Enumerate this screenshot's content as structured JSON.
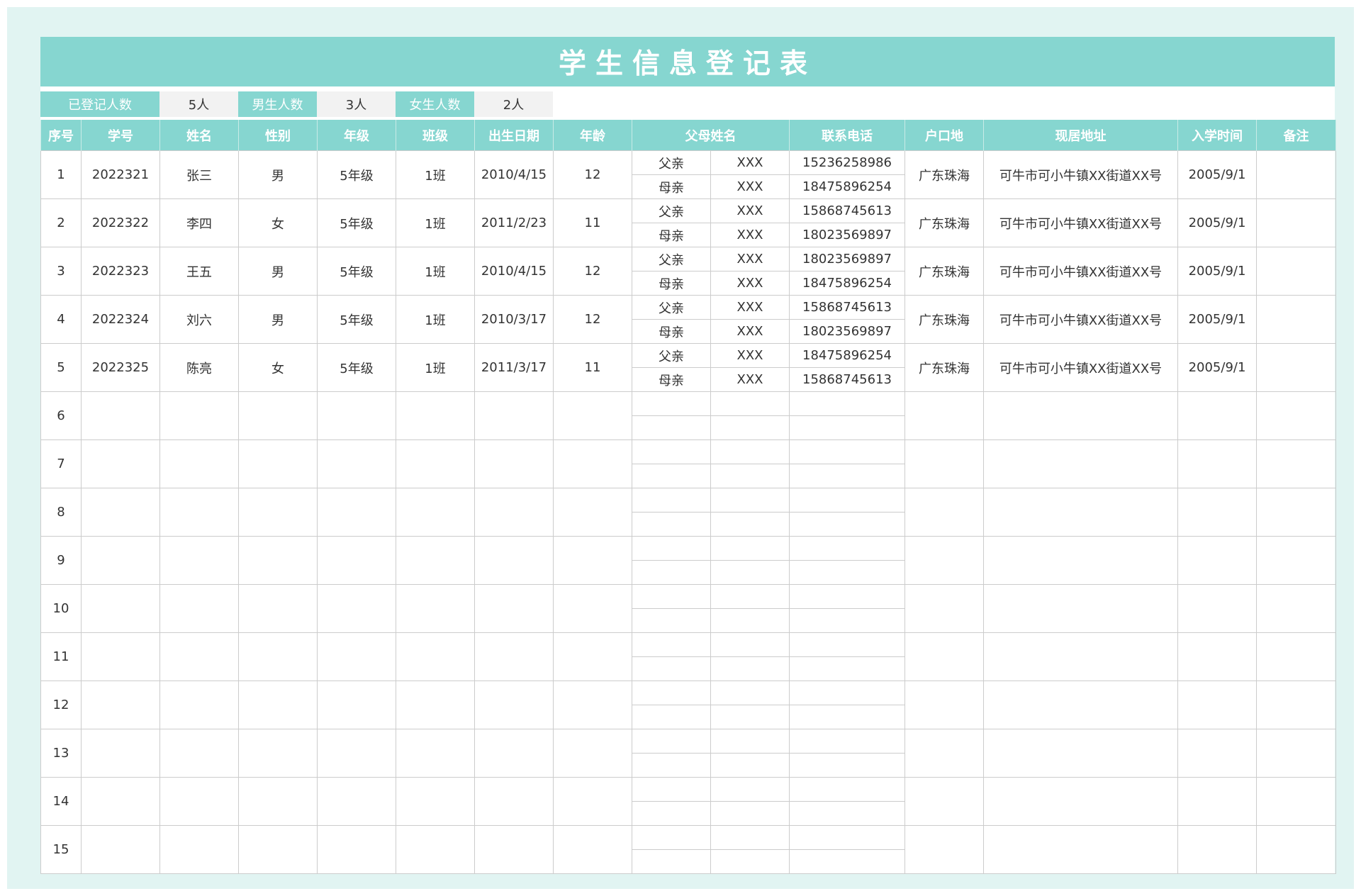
{
  "title": "学生信息登记表",
  "summary": {
    "registered_label": "已登记人数",
    "registered_value": "5人",
    "male_label": "男生人数",
    "male_value": "3人",
    "female_label": "女生人数",
    "female_value": "2人"
  },
  "columns": [
    "序号",
    "学号",
    "姓名",
    "性别",
    "年级",
    "班级",
    "出生日期",
    "年龄",
    "父母姓名",
    "联系电话",
    "户口地",
    "现居地址",
    "入学时间",
    "备注"
  ],
  "rows": [
    {
      "no": "1",
      "id": "2022321",
      "name": "张三",
      "gender": "男",
      "grade": "5年级",
      "class": "1班",
      "birth": "2010/4/15",
      "age": "12",
      "parents": [
        {
          "role": "父亲",
          "name": "XXX",
          "phone": "15236258986"
        },
        {
          "role": "母亲",
          "name": "XXX",
          "phone": "18475896254"
        }
      ],
      "hukou": "广东珠海",
      "address": "可牛市可小牛镇XX街道XX号",
      "enroll": "2005/9/1",
      "note": ""
    },
    {
      "no": "2",
      "id": "2022322",
      "name": "李四",
      "gender": "女",
      "grade": "5年级",
      "class": "1班",
      "birth": "2011/2/23",
      "age": "11",
      "parents": [
        {
          "role": "父亲",
          "name": "XXX",
          "phone": "15868745613"
        },
        {
          "role": "母亲",
          "name": "XXX",
          "phone": "18023569897"
        }
      ],
      "hukou": "广东珠海",
      "address": "可牛市可小牛镇XX街道XX号",
      "enroll": "2005/9/1",
      "note": ""
    },
    {
      "no": "3",
      "id": "2022323",
      "name": "王五",
      "gender": "男",
      "grade": "5年级",
      "class": "1班",
      "birth": "2010/4/15",
      "age": "12",
      "parents": [
        {
          "role": "父亲",
          "name": "XXX",
          "phone": "18023569897"
        },
        {
          "role": "母亲",
          "name": "XXX",
          "phone": "18475896254"
        }
      ],
      "hukou": "广东珠海",
      "address": "可牛市可小牛镇XX街道XX号",
      "enroll": "2005/9/1",
      "note": ""
    },
    {
      "no": "4",
      "id": "2022324",
      "name": "刘六",
      "gender": "男",
      "grade": "5年级",
      "class": "1班",
      "birth": "2010/3/17",
      "age": "12",
      "parents": [
        {
          "role": "父亲",
          "name": "XXX",
          "phone": "15868745613"
        },
        {
          "role": "母亲",
          "name": "XXX",
          "phone": "18023569897"
        }
      ],
      "hukou": "广东珠海",
      "address": "可牛市可小牛镇XX街道XX号",
      "enroll": "2005/9/1",
      "note": ""
    },
    {
      "no": "5",
      "id": "2022325",
      "name": "陈亮",
      "gender": "女",
      "grade": "5年级",
      "class": "1班",
      "birth": "2011/3/17",
      "age": "11",
      "parents": [
        {
          "role": "父亲",
          "name": "XXX",
          "phone": "18475896254"
        },
        {
          "role": "母亲",
          "name": "XXX",
          "phone": "15868745613"
        }
      ],
      "hukou": "广东珠海",
      "address": "可牛市可小牛镇XX街道XX号",
      "enroll": "2005/9/1",
      "note": ""
    },
    {
      "no": "6"
    },
    {
      "no": "7"
    },
    {
      "no": "8"
    },
    {
      "no": "9"
    },
    {
      "no": "10"
    },
    {
      "no": "11"
    },
    {
      "no": "12"
    },
    {
      "no": "13"
    },
    {
      "no": "14"
    },
    {
      "no": "15"
    }
  ],
  "colors": {
    "accent": "#86d6d0",
    "background": "#e1f4f2",
    "grid": "#cccccc"
  }
}
